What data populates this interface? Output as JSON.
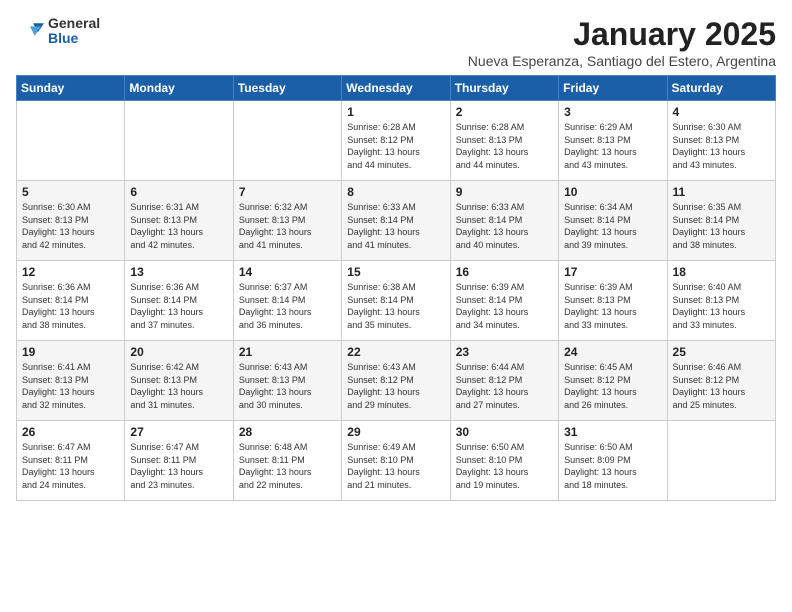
{
  "logo": {
    "general": "General",
    "blue": "Blue"
  },
  "title": "January 2025",
  "subtitle": "Nueva Esperanza, Santiago del Estero, Argentina",
  "days_of_week": [
    "Sunday",
    "Monday",
    "Tuesday",
    "Wednesday",
    "Thursday",
    "Friday",
    "Saturday"
  ],
  "weeks": [
    [
      {
        "day": null,
        "info": null
      },
      {
        "day": null,
        "info": null
      },
      {
        "day": null,
        "info": null
      },
      {
        "day": "1",
        "info": "Sunrise: 6:28 AM\nSunset: 8:12 PM\nDaylight: 13 hours\nand 44 minutes."
      },
      {
        "day": "2",
        "info": "Sunrise: 6:28 AM\nSunset: 8:13 PM\nDaylight: 13 hours\nand 44 minutes."
      },
      {
        "day": "3",
        "info": "Sunrise: 6:29 AM\nSunset: 8:13 PM\nDaylight: 13 hours\nand 43 minutes."
      },
      {
        "day": "4",
        "info": "Sunrise: 6:30 AM\nSunset: 8:13 PM\nDaylight: 13 hours\nand 43 minutes."
      }
    ],
    [
      {
        "day": "5",
        "info": "Sunrise: 6:30 AM\nSunset: 8:13 PM\nDaylight: 13 hours\nand 42 minutes."
      },
      {
        "day": "6",
        "info": "Sunrise: 6:31 AM\nSunset: 8:13 PM\nDaylight: 13 hours\nand 42 minutes."
      },
      {
        "day": "7",
        "info": "Sunrise: 6:32 AM\nSunset: 8:13 PM\nDaylight: 13 hours\nand 41 minutes."
      },
      {
        "day": "8",
        "info": "Sunrise: 6:33 AM\nSunset: 8:14 PM\nDaylight: 13 hours\nand 41 minutes."
      },
      {
        "day": "9",
        "info": "Sunrise: 6:33 AM\nSunset: 8:14 PM\nDaylight: 13 hours\nand 40 minutes."
      },
      {
        "day": "10",
        "info": "Sunrise: 6:34 AM\nSunset: 8:14 PM\nDaylight: 13 hours\nand 39 minutes."
      },
      {
        "day": "11",
        "info": "Sunrise: 6:35 AM\nSunset: 8:14 PM\nDaylight: 13 hours\nand 38 minutes."
      }
    ],
    [
      {
        "day": "12",
        "info": "Sunrise: 6:36 AM\nSunset: 8:14 PM\nDaylight: 13 hours\nand 38 minutes."
      },
      {
        "day": "13",
        "info": "Sunrise: 6:36 AM\nSunset: 8:14 PM\nDaylight: 13 hours\nand 37 minutes."
      },
      {
        "day": "14",
        "info": "Sunrise: 6:37 AM\nSunset: 8:14 PM\nDaylight: 13 hours\nand 36 minutes."
      },
      {
        "day": "15",
        "info": "Sunrise: 6:38 AM\nSunset: 8:14 PM\nDaylight: 13 hours\nand 35 minutes."
      },
      {
        "day": "16",
        "info": "Sunrise: 6:39 AM\nSunset: 8:14 PM\nDaylight: 13 hours\nand 34 minutes."
      },
      {
        "day": "17",
        "info": "Sunrise: 6:39 AM\nSunset: 8:13 PM\nDaylight: 13 hours\nand 33 minutes."
      },
      {
        "day": "18",
        "info": "Sunrise: 6:40 AM\nSunset: 8:13 PM\nDaylight: 13 hours\nand 33 minutes."
      }
    ],
    [
      {
        "day": "19",
        "info": "Sunrise: 6:41 AM\nSunset: 8:13 PM\nDaylight: 13 hours\nand 32 minutes."
      },
      {
        "day": "20",
        "info": "Sunrise: 6:42 AM\nSunset: 8:13 PM\nDaylight: 13 hours\nand 31 minutes."
      },
      {
        "day": "21",
        "info": "Sunrise: 6:43 AM\nSunset: 8:13 PM\nDaylight: 13 hours\nand 30 minutes."
      },
      {
        "day": "22",
        "info": "Sunrise: 6:43 AM\nSunset: 8:12 PM\nDaylight: 13 hours\nand 29 minutes."
      },
      {
        "day": "23",
        "info": "Sunrise: 6:44 AM\nSunset: 8:12 PM\nDaylight: 13 hours\nand 27 minutes."
      },
      {
        "day": "24",
        "info": "Sunrise: 6:45 AM\nSunset: 8:12 PM\nDaylight: 13 hours\nand 26 minutes."
      },
      {
        "day": "25",
        "info": "Sunrise: 6:46 AM\nSunset: 8:12 PM\nDaylight: 13 hours\nand 25 minutes."
      }
    ],
    [
      {
        "day": "26",
        "info": "Sunrise: 6:47 AM\nSunset: 8:11 PM\nDaylight: 13 hours\nand 24 minutes."
      },
      {
        "day": "27",
        "info": "Sunrise: 6:47 AM\nSunset: 8:11 PM\nDaylight: 13 hours\nand 23 minutes."
      },
      {
        "day": "28",
        "info": "Sunrise: 6:48 AM\nSunset: 8:11 PM\nDaylight: 13 hours\nand 22 minutes."
      },
      {
        "day": "29",
        "info": "Sunrise: 6:49 AM\nSunset: 8:10 PM\nDaylight: 13 hours\nand 21 minutes."
      },
      {
        "day": "30",
        "info": "Sunrise: 6:50 AM\nSunset: 8:10 PM\nDaylight: 13 hours\nand 19 minutes."
      },
      {
        "day": "31",
        "info": "Sunrise: 6:50 AM\nSunset: 8:09 PM\nDaylight: 13 hours\nand 18 minutes."
      },
      {
        "day": null,
        "info": null
      }
    ]
  ]
}
